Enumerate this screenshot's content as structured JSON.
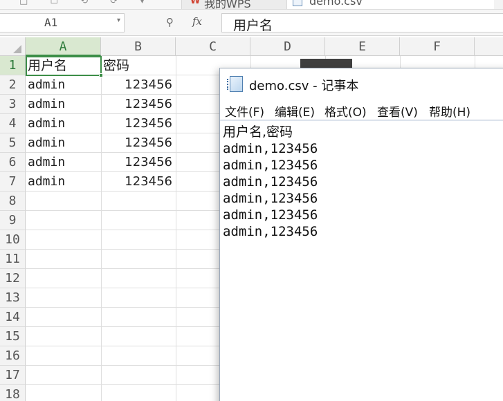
{
  "tabs": {
    "left_icons": "□ ☐ ⟲ ⟳ ▾",
    "wps": {
      "label": "我的WPS"
    },
    "csv": {
      "label": "demo.csv"
    }
  },
  "formula_bar": {
    "name_box": "A1",
    "name_box_arrow": "▾",
    "zoom_icon": "⚲",
    "fx": "fx",
    "formula": "用户名"
  },
  "columns": [
    "A",
    "B",
    "C",
    "D",
    "E",
    "F"
  ],
  "rows": [
    "1",
    "2",
    "3",
    "4",
    "5",
    "6",
    "7",
    "8",
    "9",
    "10",
    "11",
    "12",
    "13",
    "14",
    "15",
    "16",
    "17",
    "18"
  ],
  "cells": [
    {
      "a": "用户名",
      "b": "密码"
    },
    {
      "a": "admin",
      "b": "123456"
    },
    {
      "a": "admin",
      "b": "123456"
    },
    {
      "a": "admin",
      "b": "123456"
    },
    {
      "a": "admin",
      "b": "123456"
    },
    {
      "a": "admin",
      "b": "123456"
    },
    {
      "a": "admin",
      "b": "123456"
    }
  ],
  "notepad": {
    "title": "demo.csv - 记事本",
    "menu": [
      "文件(F)",
      "编辑(E)",
      "格式(O)",
      "查看(V)",
      "帮助(H)"
    ],
    "lines": [
      "用户名,密码",
      "admin,123456",
      "admin,123456",
      "admin,123456",
      "admin,123456",
      "admin,123456",
      "admin,123456"
    ]
  },
  "colors": {
    "selection": "#3c8e47",
    "header_active_bg": "#d9e8d0",
    "wps_logo": "#d0402f"
  }
}
